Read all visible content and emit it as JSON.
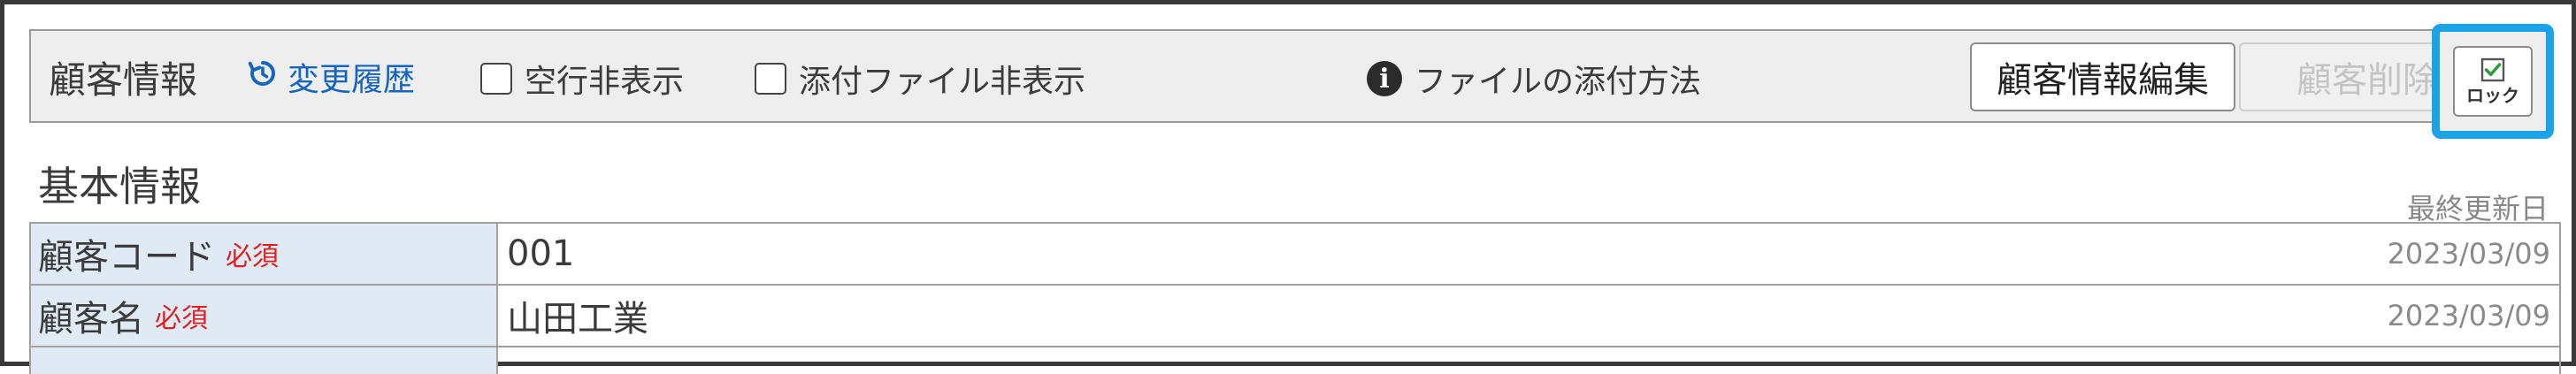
{
  "toolbar": {
    "title": "顧客情報",
    "history_label": "変更履歴",
    "hide_empty_rows_label": "空行非表示",
    "hide_attachments_label": "添付ファイル非表示",
    "attach_method_label": "ファイルの添付方法",
    "edit_button_label": "顧客情報編集",
    "delete_button_label": "顧客削除",
    "lock_button_label": "ロック",
    "highlight_color": "#1ba3e8"
  },
  "section": {
    "title": "基本情報",
    "last_updated_header": "最終更新日"
  },
  "fields": [
    {
      "label": "顧客コード",
      "required": "必須",
      "value": "001",
      "updated": "2023/03/09"
    },
    {
      "label": "顧客名",
      "required": "必須",
      "value": "山田工業",
      "updated": "2023/03/09"
    }
  ]
}
